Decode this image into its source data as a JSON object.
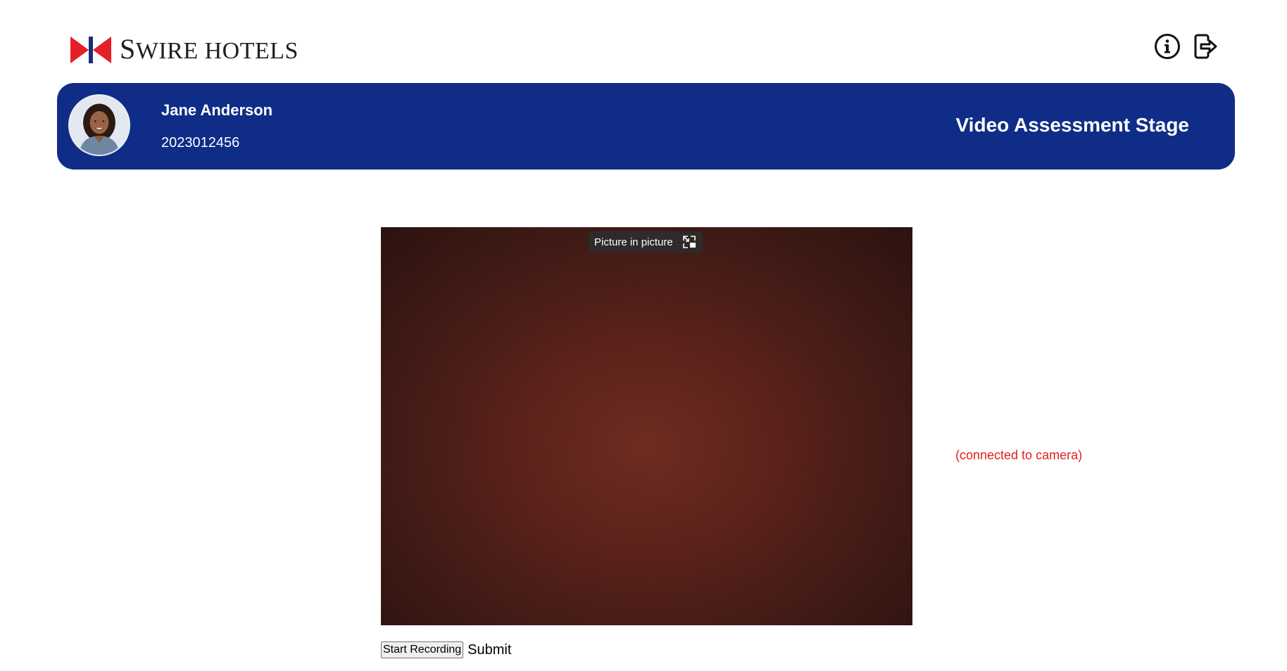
{
  "header": {
    "logo_text_lead": "S",
    "logo_text_rest": "WIRE HOTELS",
    "icons": [
      "info-icon",
      "logout-icon"
    ]
  },
  "banner": {
    "name": "Jane Anderson",
    "id": "2023012456",
    "stage": "Video Assessment Stage",
    "bg_color": "#0f2d86"
  },
  "video": {
    "pip_label": "Picture in picture",
    "status": "(connected to camera)",
    "status_color": "#e02020"
  },
  "controls": {
    "start_label": "Start Recording",
    "submit_label": "Submit"
  }
}
